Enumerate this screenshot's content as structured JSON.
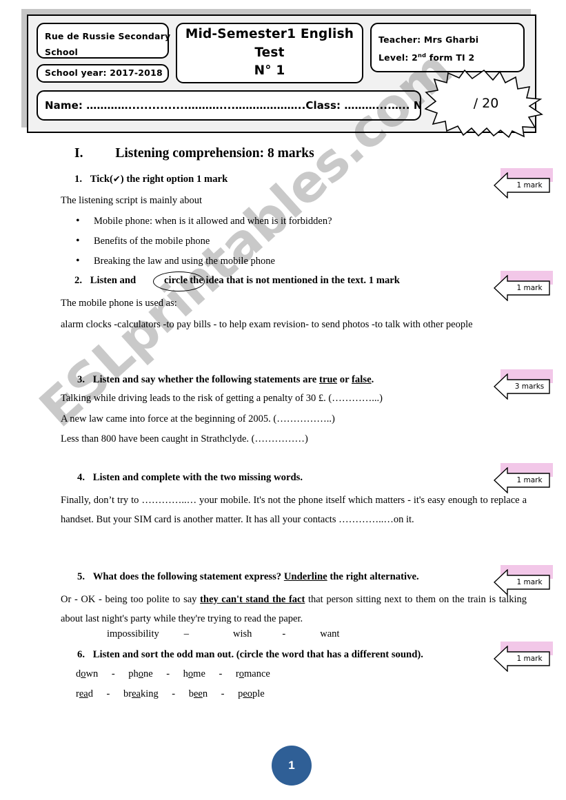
{
  "header": {
    "school_name": "Rue de Russie Secondary",
    "school_name2": "School",
    "school_year": "School year: 2017-2018",
    "test_title_line1": "Mid-Semester1 English Test",
    "test_title_line2": "N° 1",
    "teacher": "Teacher: Mrs Gharbi",
    "level_prefix": "Level: 2",
    "level_sup": "nd",
    "level_suffix": " form TI 2",
    "id_line": "Name: …………...............………....………………..Class: ………....….. N°: …..",
    "score_out_of": "/ 20"
  },
  "section": {
    "numeral": "I.",
    "title": "Listening comprehension: 8 marks"
  },
  "questions": {
    "q1": {
      "number": "1.",
      "prompt_before": "Tick(",
      "tick_glyph": "✔",
      "prompt_after": ") the right option 1 mark",
      "intro": "The listening script is mainly about",
      "options": [
        "Mobile phone: when is it allowed and when is it forbidden?",
        "Benefits of the mobile phone",
        "Breaking the law and using the mobile phone"
      ]
    },
    "q2": {
      "number": "2.",
      "prompt_a": "Listen and",
      "circled_word": "circle",
      "prompt_b": "the idea that is not mentioned in the text. 1 mark",
      "intro": "The mobile phone is used as:",
      "items": "alarm clocks  -calculators   -to pay bills - to help exam revision- to send photos -to talk with other people"
    },
    "q3": {
      "number": "3.",
      "prompt_a": "Listen and say whether the following statements are ",
      "true_word": "true",
      "prompt_or": " or ",
      "false_word": "false",
      "prompt_end": ".",
      "statements": [
        "Talking while driving leads to the risk of getting a penalty of 30 £. (…………...)",
        "A new law came into force at the beginning of 2005. (……………..)",
        "Less than 800 have been caught in Strathclyde. (……………)"
      ]
    },
    "q4": {
      "number": "4.",
      "prompt": "Listen and complete with the two missing words.",
      "passage": "Finally, don’t try to …………..… your mobile. It's not the phone itself which matters - it's easy enough to replace a handset. But your SIM card is another matter. It has all your contacts …………..…on it."
    },
    "q5": {
      "number": "5.",
      "prompt_a": "What does the following statement express? ",
      "underlined": "Underline",
      "prompt_b": " the right alternative.",
      "statement_a": "Or - OK - being too polite to say ",
      "statement_bold_underline": "they can't stand the fact",
      "statement_b": " that person sitting next to them on the train is talking about last night's party while they're trying to read the paper.",
      "alternatives": [
        "impossibility",
        "–",
        "wish",
        "-",
        "want"
      ]
    },
    "q6": {
      "number": "6.",
      "prompt": "Listen and sort the odd man out. (circle the word that has a different sound).",
      "row1": [
        {
          "pre": "d",
          "mid": "o",
          "post": "wn"
        },
        {
          "sep": "-"
        },
        {
          "pre": "ph",
          "mid": "o",
          "post": "ne"
        },
        {
          "sep": "-"
        },
        {
          "pre": "h",
          "mid": "o",
          "post": "me"
        },
        {
          "sep": "-"
        },
        {
          "pre": "r",
          "mid": "o",
          "post": "mance"
        }
      ],
      "row2": [
        {
          "pre": "r",
          "mid": "ea",
          "post": "d"
        },
        {
          "sep": "-"
        },
        {
          "pre": "br",
          "mid": "ea",
          "post": "king"
        },
        {
          "sep": "-"
        },
        {
          "pre": "b",
          "mid": "ee",
          "post": "n"
        },
        {
          "sep": "-"
        },
        {
          "pre": "p",
          "mid": "eo",
          "post": "ple"
        }
      ]
    }
  },
  "callouts": [
    {
      "label": "1 mark"
    },
    {
      "label": "1 mark"
    },
    {
      "label": "3 marks"
    },
    {
      "label": "1 mark"
    },
    {
      "label": "1 mark"
    },
    {
      "label": "1 mark"
    }
  ],
  "footer": {
    "page_number": "1"
  },
  "watermark": {
    "text": "ESLprintables.com"
  },
  "colors": {
    "page_badge_bg": "#2f5f96",
    "callout_shadow": "#f2c7e8",
    "header_panel": "#f1f1f1",
    "header_shadow": "#c6c6c6"
  }
}
